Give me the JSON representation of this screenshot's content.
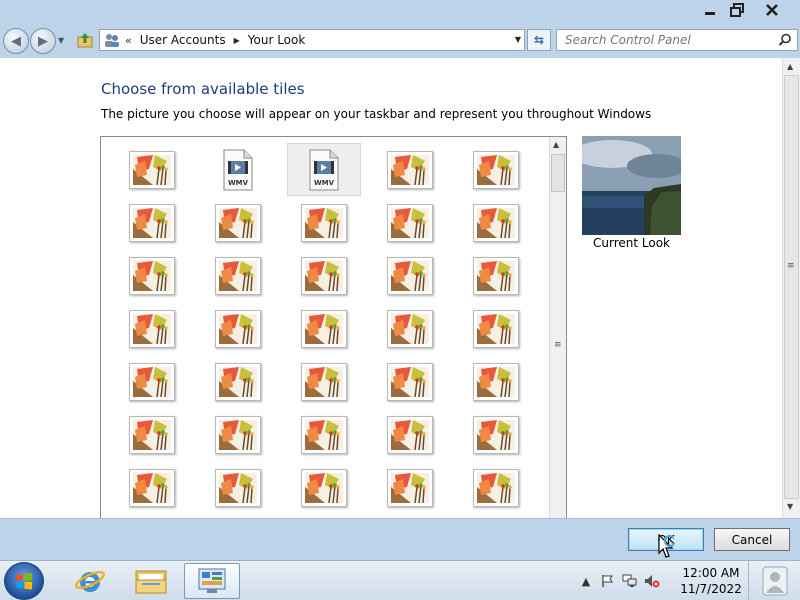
{
  "window": {
    "minimize_icon": "minimize-icon",
    "maximize_icon": "restore-icon",
    "close_icon": "close-icon"
  },
  "nav": {
    "back_icon": "back-arrow-icon",
    "forward_icon": "forward-arrow-icon",
    "breadcrumb": [
      "User Accounts",
      "Your Look"
    ],
    "breadcrumb_overflow": "«",
    "search": {
      "placeholder": "Search Control Panel"
    }
  },
  "main": {
    "heading": "Choose from available tiles",
    "subtitle": "The picture you choose will appear on your taskbar and represent you throughout Windows",
    "tiles": [
      {
        "kind": "image"
      },
      {
        "kind": "wmv",
        "label": "WMV"
      },
      {
        "kind": "wmv",
        "label": "WMV",
        "selected": true
      },
      {
        "kind": "image"
      },
      {
        "kind": "image"
      },
      {
        "kind": "image"
      },
      {
        "kind": "image"
      },
      {
        "kind": "image"
      },
      {
        "kind": "image"
      },
      {
        "kind": "image"
      },
      {
        "kind": "image"
      },
      {
        "kind": "image"
      },
      {
        "kind": "image"
      },
      {
        "kind": "image"
      },
      {
        "kind": "image"
      },
      {
        "kind": "image"
      },
      {
        "kind": "image"
      },
      {
        "kind": "image"
      },
      {
        "kind": "image"
      },
      {
        "kind": "image"
      },
      {
        "kind": "image"
      },
      {
        "kind": "image"
      },
      {
        "kind": "image"
      },
      {
        "kind": "image"
      },
      {
        "kind": "image"
      },
      {
        "kind": "image"
      },
      {
        "kind": "image"
      },
      {
        "kind": "image"
      },
      {
        "kind": "image"
      },
      {
        "kind": "image"
      },
      {
        "kind": "image"
      },
      {
        "kind": "image"
      },
      {
        "kind": "image"
      },
      {
        "kind": "image"
      },
      {
        "kind": "image"
      }
    ],
    "current_look_label": "Current Look"
  },
  "buttons": {
    "ok": "OK",
    "cancel": "Cancel"
  },
  "taskbar": {
    "start_icon": "windows-start-icon",
    "pinned": [
      "internet-explorer-icon",
      "windows-explorer-icon",
      "control-panel-icon"
    ],
    "tray_icons": [
      "show-hidden-icons",
      "action-center-flag-icon",
      "network-icon",
      "volume-muted-icon"
    ],
    "time": "12:00 AM",
    "date": "11/7/2022"
  },
  "colors": {
    "chrome": "#bcd3ea",
    "heading": "#1e3c7b",
    "ok_border": "#3c7fb1"
  }
}
